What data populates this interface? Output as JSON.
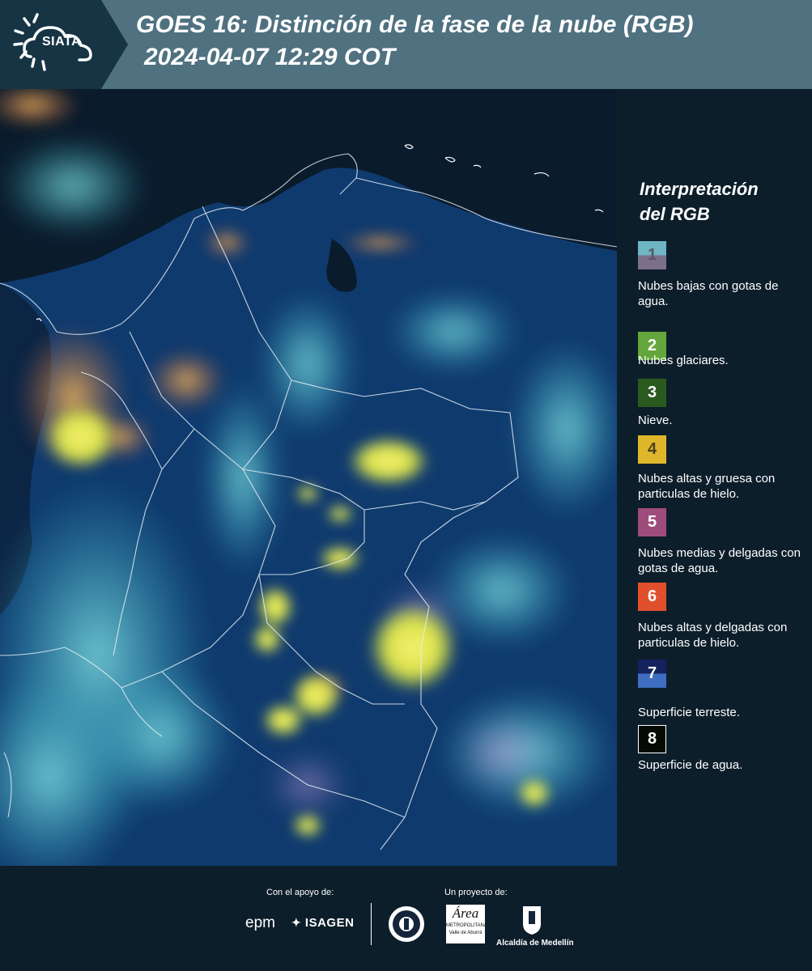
{
  "header": {
    "logo_text": "SIATA",
    "title_line1": "GOES 16: Distinción de la fase de la nube (RGB)",
    "title_line2": "2024-04-07 12:29 COT"
  },
  "legend": {
    "title_line1": "Interpretación",
    "title_line2": "del RGB",
    "items": [
      {
        "number": "1",
        "label": "Nubes bajas con gotas de agua.",
        "color_top": "#6fb6c4",
        "color_bottom": "#7b6f8a",
        "number_color": "#5a5a6a"
      },
      {
        "number": "2",
        "label": "Nubes glaciares.",
        "color_top": "#64a53c",
        "color_bottom": "#64a53c",
        "number_color": "#ffffff"
      },
      {
        "number": "3",
        "label": "Nieve.",
        "color_top": "#2b5a1f",
        "color_bottom": "#2b5a1f",
        "number_color": "#ffffff"
      },
      {
        "number": "4",
        "label": "Nubes altas y gruesa con particulas de hielo.",
        "color_top": "#e0b72a",
        "color_bottom": "#e0b72a",
        "number_color": "#4a4020"
      },
      {
        "number": "5",
        "label": "Nubes medias y delgadas con gotas de agua.",
        "color_top": "#9e4c7c",
        "color_bottom": "#9e4c7c",
        "number_color": "#ffffff"
      },
      {
        "number": "6",
        "label": "Nubes altas y delgadas con particulas de hielo.",
        "color_top": "#e0502d",
        "color_bottom": "#e0502d",
        "number_color": "#ffffff"
      },
      {
        "number": "7",
        "label": "Superficie terreste.",
        "color_top": "#14225e",
        "color_bottom": "#3f6ec0",
        "number_color": "#ffffff"
      },
      {
        "number": "8",
        "label": "Superficie de agua.",
        "color_top": "#050a05",
        "color_bottom": "#050a05",
        "number_color": "#ffffff"
      }
    ]
  },
  "footer": {
    "support_label": "Con el apoyo de:",
    "project_label": "Un proyecto de:",
    "sponsor1": "epm",
    "sponsor2": "ISAGEN",
    "partner_amva_1": "Área",
    "partner_amva_2": "METROPOLITANA",
    "partner_amva_3": "Valle de Aburrá",
    "partner_alcaldia": "Alcaldía de Medellín"
  }
}
